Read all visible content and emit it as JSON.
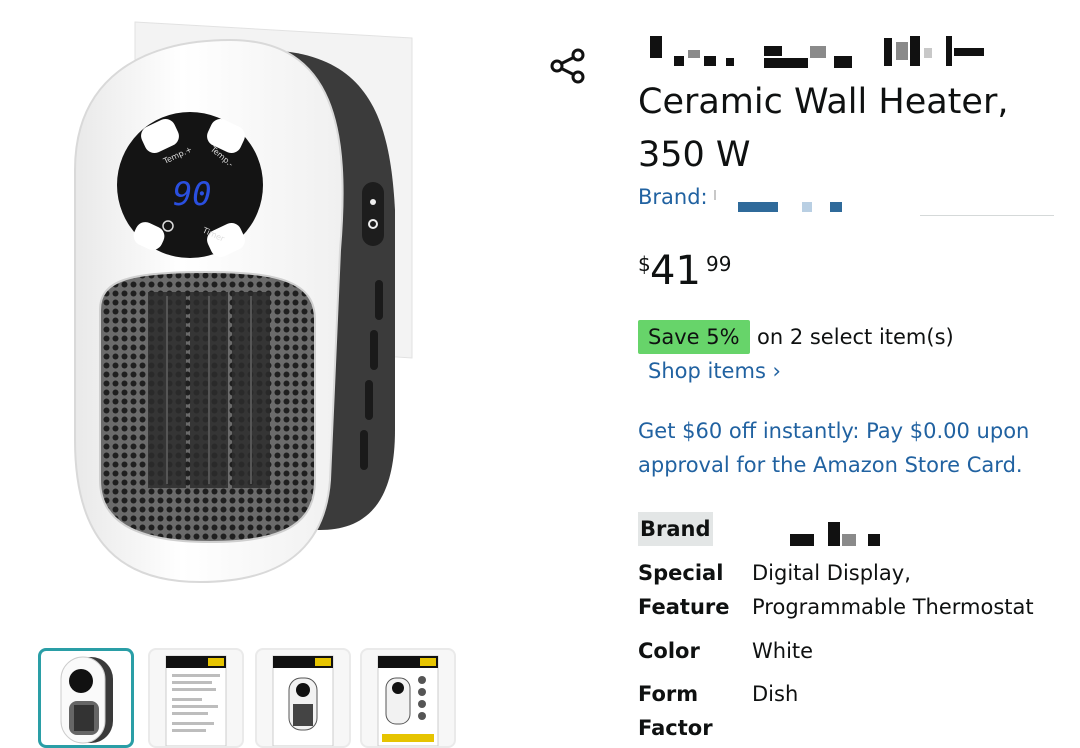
{
  "product": {
    "title": "Ceramic Wall Heater, 350 W",
    "brand_prefix": "Brand: ",
    "price": {
      "symbol": "$",
      "whole": "41",
      "fraction": "99"
    },
    "promo": {
      "badge": "Save 5%",
      "text": "on 2 select item(s)",
      "link": "Shop items ›"
    },
    "card_offer": "Get $60 off instantly: Pay $0.00 upon approval for the Amazon Store Card.",
    "display_reading": "90",
    "control_labels": {
      "temp_plus": "Temp.+",
      "temp_minus": "Temp.-",
      "timer": "Timer"
    }
  },
  "specs": [
    {
      "label": "Brand",
      "value": ""
    },
    {
      "label": "Special Feature",
      "value": "Digital Display, Programmable Thermostat"
    },
    {
      "label": "Color",
      "value": "White"
    },
    {
      "label": "Form Factor",
      "value": "Dish"
    }
  ],
  "icons": {
    "share": "share-icon"
  },
  "colors": {
    "link": "#2162a1",
    "save_badge": "#67d46a",
    "thumb_active_border": "#2a9ea6"
  }
}
